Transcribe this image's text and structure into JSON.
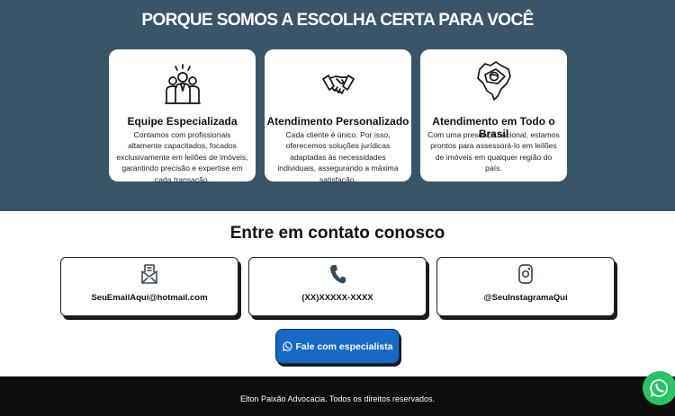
{
  "hero": {
    "title": "PORQUE SOMOS A ESCOLHA CERTA PARA VOCÊ",
    "background": "#3a5568",
    "cards": [
      {
        "icon": "team-icon",
        "title": "Equipe Especializada",
        "description": "Contamos com profissionais altamente capacitados, focados exclusivamente em leilões de imóveis, garantindo precisão e expertise em cada transação."
      },
      {
        "icon": "handshake-icon",
        "title": "Atendimento Personalizado",
        "description": "Cada cliente é único. Por isso, oferecemos soluções jurídicas adaptadas às necessidades individuais, assegurando a máxima satisfação."
      },
      {
        "icon": "brazil-map-icon",
        "title": "Atendimento em Todo o Brasil",
        "description": "Com uma presença nacional, estamos prontos para assessorá-lo em leilões de imóveis em qualquer região do país."
      }
    ]
  },
  "contact": {
    "title": "Entre em contato conosco",
    "items": [
      {
        "icon": "envelope-icon",
        "text": "SeuEmailAqui@hotmail.com"
      },
      {
        "icon": "phone-icon",
        "text": "(XX)XXXXX-XXXX"
      },
      {
        "icon": "instagram-icon",
        "text": "@SeuInstagramaQui"
      }
    ],
    "cta": {
      "icon": "whatsapp-icon",
      "label": "Fale com especialista",
      "color": "#1769c6"
    }
  },
  "footer": {
    "text": "Elton Paixão Advocacia. Todos os direitos reservados."
  },
  "whatsapp_fab": {
    "icon": "whatsapp-icon",
    "color": "#27c364"
  }
}
